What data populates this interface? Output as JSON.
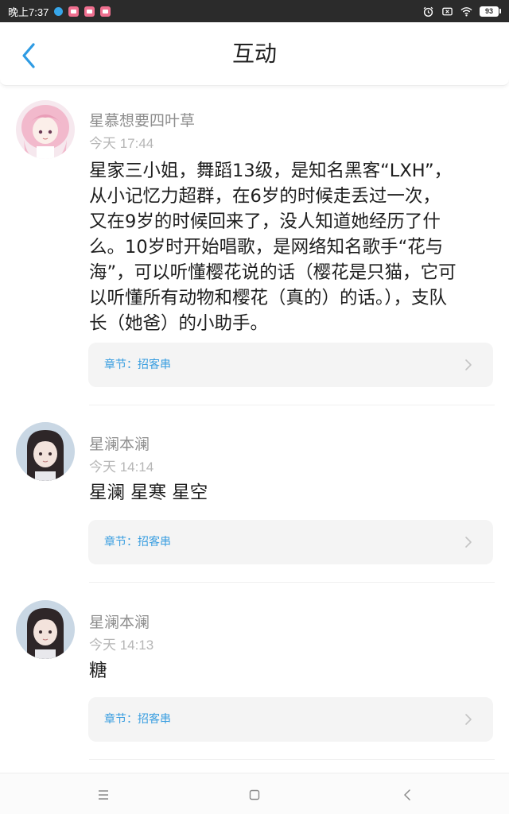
{
  "status_bar": {
    "time": "晚上7:37",
    "battery": "93"
  },
  "header": {
    "title": "互动",
    "back_icon": "chevron-left-icon"
  },
  "comments": [
    {
      "username": "星慕想要四叶草",
      "time": "今天 17:44",
      "text": "星家三小姐，舞蹈13级，是知名黑客“LXH”，\n从小记忆力超群，在6岁的时候走丢过一次，\n又在9岁的时候回来了，没人知道她经历了什\n么。10岁时开始唱歌，是网络知名歌手“花与\n海”，可以听懂樱花说的话（樱花是只猫，它可\n以听懂所有动物和樱花（真的）的话。），支队\n长（她爸）的小助手。",
      "chapter": "章节：招客串"
    },
    {
      "username": "星澜本澜",
      "time": "今天 14:14",
      "text": "星澜 星寒 星空",
      "chapter": "章节：招客串"
    },
    {
      "username": "星澜本澜",
      "time": "今天 14:13",
      "text": "糖",
      "chapter": "章节：招客串"
    }
  ],
  "colors": {
    "accent": "#3a9ee0",
    "status_bar": "#2b2b2b",
    "card_bg": "#f4f4f4"
  },
  "nav": {
    "menu_icon": "menu-icon",
    "home_icon": "square-home-icon",
    "back_icon": "triangle-back-icon"
  }
}
